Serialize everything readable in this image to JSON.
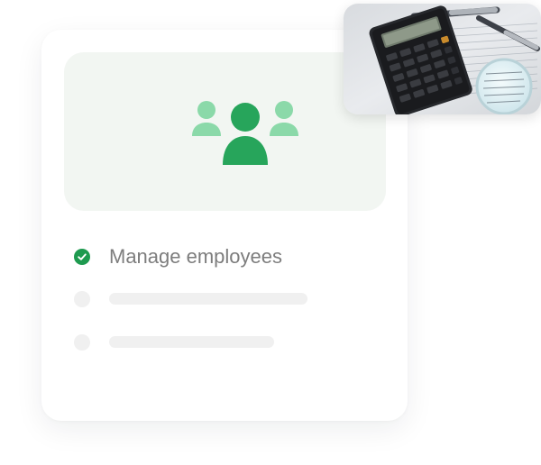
{
  "checklist": {
    "item1_label": "Manage employees"
  },
  "icons": {
    "team": "team-group-icon",
    "check": "check-circle-icon"
  },
  "colors": {
    "accent_green": "#1e9a4f",
    "icon_green_dark": "#27a55b",
    "icon_green_light": "#8bd9a9",
    "hero_background": "#f2f6f2",
    "placeholder_gray": "#f0f0f0",
    "label_gray": "#7d7d7d"
  },
  "photo": {
    "subject": "calculator-with-pen-and-magnifier-on-papers"
  }
}
